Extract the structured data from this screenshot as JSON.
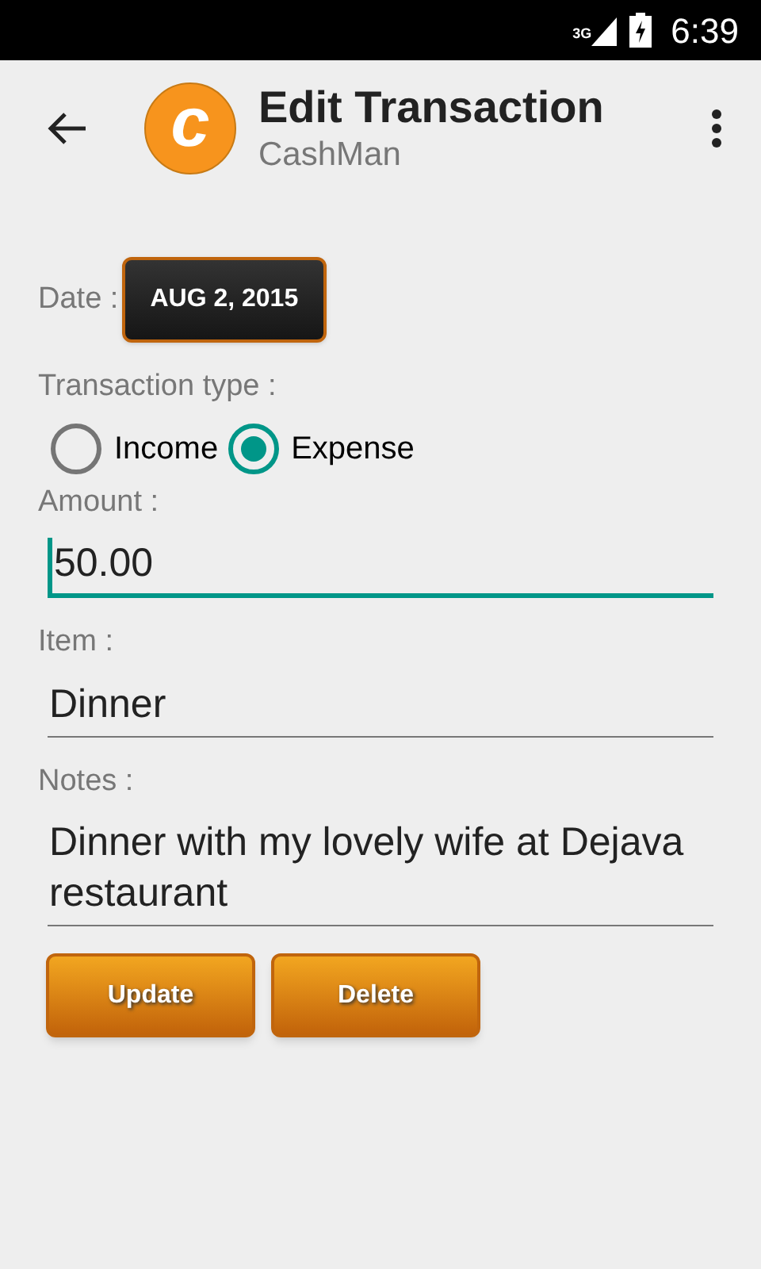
{
  "status_bar": {
    "network": "3G",
    "time": "6:39"
  },
  "app_bar": {
    "logo": "c",
    "title": "Edit Transaction",
    "subtitle": "CashMan"
  },
  "date": {
    "label": "Date :",
    "value": "AUG 2, 2015"
  },
  "transaction_type": {
    "label": "Transaction type :",
    "options": [
      {
        "label": "Income",
        "selected": false
      },
      {
        "label": "Expense",
        "selected": true
      }
    ]
  },
  "fields": [
    {
      "label": "Amount :",
      "value": "50.00",
      "focused": true
    },
    {
      "label": "Item :",
      "value": "Dinner",
      "focused": false
    },
    {
      "label": "Notes :",
      "value": "Dinner with my lovely wife at Dejava restaurant",
      "focused": false
    }
  ],
  "buttons": [
    "Update",
    "Delete"
  ]
}
